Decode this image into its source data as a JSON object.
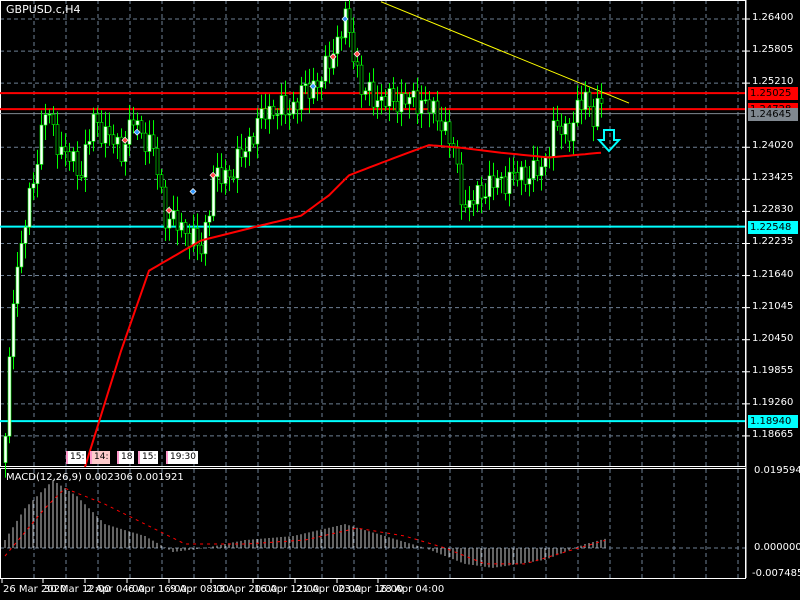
{
  "title": "GBPUSD.c,H4",
  "price_axis": [
    "1.26400",
    "1.25805",
    "1.25210",
    "1.24020",
    "1.23425",
    "1.22830",
    "1.22235",
    "1.21640",
    "1.21045",
    "1.20450",
    "1.19855",
    "1.19260",
    "1.18665"
  ],
  "price_tags": [
    {
      "value": "1.25025",
      "color": "#ff0000",
      "text_color": "#000000"
    },
    {
      "value": "1.24728",
      "color": "#ff0000",
      "text_color": "#000000"
    },
    {
      "value": "1.24645",
      "color": "#808890",
      "text_color": "#000000"
    },
    {
      "value": "1.22548",
      "color": "#00ffff",
      "text_color": "#000000"
    },
    {
      "value": "1.18940",
      "color": "#00ffff",
      "text_color": "#000000"
    }
  ],
  "time_axis": [
    "26 Mar 2020",
    "30 Mar 12:00",
    "2 Apr 04:00",
    "6 Apr 16:00",
    "9 Apr 08:00",
    "13 Apr 20:00",
    "16 Apr 12:00",
    "21 Apr 00:00",
    "23 Apr 16:00",
    "28 Apr 04:00"
  ],
  "time_markers": [
    "15:",
    "14:",
    "18",
    "15:",
    "19:30"
  ],
  "macd": {
    "label": "MACD(12,26,9) 0.002306 0.001921",
    "axis": [
      "0.019594",
      "0.000000",
      "-0.007485"
    ]
  },
  "colors": {
    "candle": "#00ff00",
    "ma": "#ff0000",
    "trendline": "#ffff00",
    "support": "#00ffff",
    "resistance": "#ff0000",
    "grid": "#6e7f94"
  },
  "chart_data": {
    "type": "candlestick",
    "title": "GBPUSD.c,H4",
    "ylim": [
      1.1809,
      1.2675
    ],
    "close_path": [
      [
        0,
        1.1857
      ],
      [
        2,
        1.2136
      ],
      [
        6,
        1.2303
      ],
      [
        10,
        1.2471
      ],
      [
        14,
        1.2396
      ],
      [
        19,
        1.2359
      ],
      [
        22,
        1.2452
      ],
      [
        29,
        1.2396
      ],
      [
        32,
        1.2452
      ],
      [
        37,
        1.2396
      ],
      [
        40,
        1.2275
      ],
      [
        45,
        1.2248
      ],
      [
        49,
        1.221
      ],
      [
        52,
        1.2341
      ],
      [
        57,
        1.2359
      ],
      [
        61,
        1.2415
      ],
      [
        65,
        1.2471
      ],
      [
        71,
        1.2471
      ],
      [
        75,
        1.2508
      ],
      [
        79,
        1.2527
      ],
      [
        82,
        1.2582
      ],
      [
        85,
        1.2638
      ],
      [
        87,
        1.2582
      ],
      [
        89,
        1.2508
      ],
      [
        94,
        1.2489
      ],
      [
        99,
        1.2489
      ],
      [
        104,
        1.2489
      ],
      [
        109,
        1.2452
      ],
      [
        112,
        1.2396
      ],
      [
        115,
        1.2285
      ],
      [
        119,
        1.2322
      ],
      [
        124,
        1.2341
      ],
      [
        129,
        1.235
      ],
      [
        134,
        1.2359
      ],
      [
        137,
        1.2434
      ],
      [
        141,
        1.2434
      ],
      [
        145,
        1.2499
      ],
      [
        147,
        1.2461
      ],
      [
        149,
        1.248
      ]
    ],
    "moving_average": [
      [
        20,
        1.1809
      ],
      [
        29,
        1.2024
      ],
      [
        36,
        1.2173
      ],
      [
        49,
        1.2229
      ],
      [
        64,
        1.2257
      ],
      [
        74,
        1.2275
      ],
      [
        81,
        1.2313
      ],
      [
        86,
        1.235
      ],
      [
        99,
        1.2387
      ],
      [
        106,
        1.2406
      ],
      [
        114,
        1.2401
      ],
      [
        124,
        1.2392
      ],
      [
        136,
        1.2383
      ],
      [
        149,
        1.2392
      ]
    ],
    "macd_main": [
      [
        0,
        0.002
      ],
      [
        5,
        0.01
      ],
      [
        12,
        0.017
      ],
      [
        18,
        0.013
      ],
      [
        25,
        0.006
      ],
      [
        35,
        0.003
      ],
      [
        42,
        -0.001
      ],
      [
        50,
        0.0
      ],
      [
        60,
        0.002
      ],
      [
        72,
        0.003
      ],
      [
        85,
        0.006
      ],
      [
        95,
        0.003
      ],
      [
        105,
        0.0
      ],
      [
        115,
        -0.004
      ],
      [
        122,
        -0.005
      ],
      [
        135,
        -0.003
      ],
      [
        145,
        0.001
      ],
      [
        150,
        0.0023
      ]
    ],
    "macd_signal": [
      [
        0,
        -0.002
      ],
      [
        10,
        0.01
      ],
      [
        15,
        0.015
      ],
      [
        25,
        0.011
      ],
      [
        35,
        0.006
      ],
      [
        45,
        0.001
      ],
      [
        60,
        0.001
      ],
      [
        75,
        0.002
      ],
      [
        88,
        0.005
      ],
      [
        100,
        0.003
      ],
      [
        110,
        0.0
      ],
      [
        120,
        -0.004
      ],
      [
        130,
        -0.004
      ],
      [
        140,
        -0.001
      ],
      [
        150,
        0.0019
      ]
    ],
    "horizontal_lines": [
      1.25025,
      1.24728,
      1.22548,
      1.1894
    ],
    "trendline": [
      [
        94,
        1.2672
      ],
      [
        156,
        1.2484
      ]
    ]
  }
}
